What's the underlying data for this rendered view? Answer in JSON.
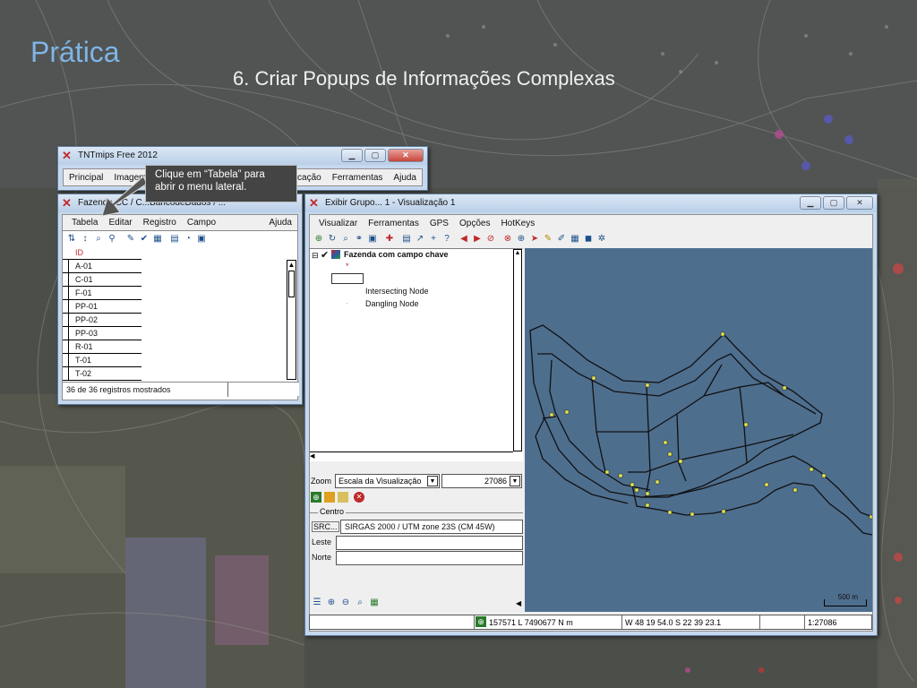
{
  "slide": {
    "title": "Prática",
    "subtitle": "6. Criar Popups de Informações Complexas"
  },
  "colors": {
    "title_accent": "#7fb5e6",
    "map_background": "#4e6e8e",
    "node_marker": "#e8e850",
    "id_header": "#c0282a"
  },
  "main_window": {
    "title": "TNTmips Free 2012",
    "icon": "tntmips-app-icon",
    "menu": [
      "Principal",
      "Imagem",
      "plicação",
      "Ferramentas",
      "Ajuda"
    ]
  },
  "callout": {
    "text": "Clique em “Tabela” para abrir o menu lateral."
  },
  "table_window": {
    "title": "Fazenda CC / C...BancodeDados / ...",
    "menu": [
      "Tabela",
      "Editar",
      "Registro",
      "Campo"
    ],
    "menu_help": "Ajuda",
    "toolbar_icons": [
      "sort-icon",
      "sort-asc-icon",
      "find-icon",
      "filter-icon",
      "tag-icon",
      "select-all-icon",
      "table-icon",
      "form-icon",
      "graph-icon",
      "print-icon"
    ],
    "column_header": "ID",
    "rows": [
      "A-01",
      "C-01",
      "F-01",
      "PP-01",
      "PP-02",
      "PP-03",
      "R-01",
      "T-01",
      "T-02"
    ],
    "status": "36 de 36 registros mostrados"
  },
  "display_window": {
    "title": "Exibir Grupo... 1 - Visualização 1",
    "menu": [
      "Visualizar",
      "Ferramentas",
      "GPS",
      "Opções",
      "HotKeys"
    ],
    "layer_name": "Fazenda com campo chave",
    "legend_items": [
      "Intersecting Node",
      "Dangling Node"
    ],
    "zoom_label": "Zoom",
    "zoom_mode": "Escala da Visualização",
    "zoom_value": "27086",
    "center_group_label": "Centro",
    "src_label": "SRC...",
    "src_value": "SIRGAS 2000 / UTM zone 23S (CM 45W)",
    "leste_label": "Leste",
    "norte_label": "Norte",
    "scale_bar_label": "500 m",
    "status_coords": "157571 L  7490677 N m",
    "status_latlon": "W 48 19 54.0  S 22 39 23.1",
    "status_scale": "1:27086"
  }
}
